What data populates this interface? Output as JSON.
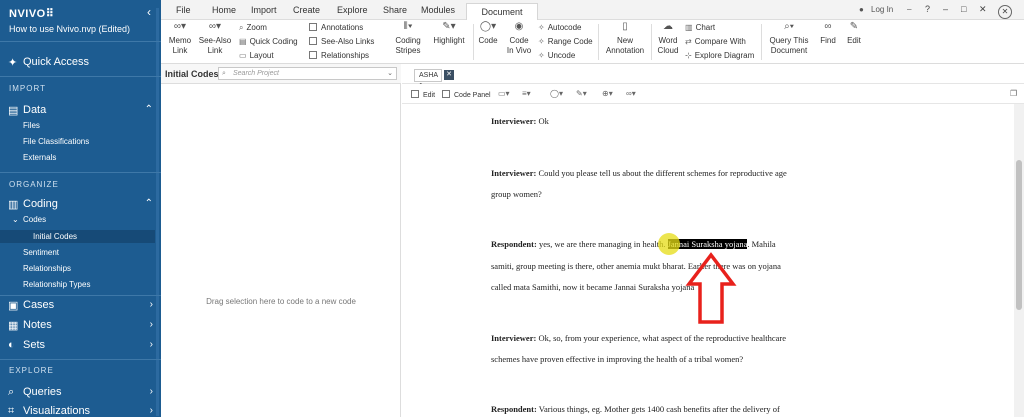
{
  "sidebar": {
    "logo": "NVIVO",
    "logo_dots": "⠿",
    "project_name": "How to use Nvivo.nvp (Edited)",
    "quick_access": "Quick Access",
    "sections": {
      "import": "IMPORT",
      "organize": "ORGANIZE",
      "explore": "EXPLORE"
    },
    "data": {
      "label": "Data",
      "items": [
        "Files",
        "File Classifications",
        "Externals"
      ]
    },
    "coding": {
      "label": "Coding",
      "codes_label": "Codes",
      "initial_codes": "Initial Codes",
      "items": [
        "Sentiment",
        "Relationships",
        "Relationship Types"
      ]
    },
    "cases": "Cases",
    "notes": "Notes",
    "sets": "Sets",
    "queries": "Queries",
    "visualizations": "Visualizations"
  },
  "ribbon": {
    "tabs": [
      "File",
      "Home",
      "Import",
      "Create",
      "Explore",
      "Share",
      "Modules"
    ],
    "active_tab": "Document",
    "login": "Log In",
    "buttons": {
      "memo_link": [
        "Memo",
        "Link"
      ],
      "see_also_link": [
        "See-Also",
        "Link"
      ],
      "zoom": "Zoom",
      "quick_coding": "Quick Coding",
      "layout": "Layout",
      "annotations": "Annotations",
      "see_also_links": "See-Also Links",
      "relationships": "Relationships",
      "coding_stripes": [
        "Coding",
        "Stripes"
      ],
      "highlight": "Highlight",
      "code": "Code",
      "code_in_vivo": [
        "Code",
        "In Vivo"
      ],
      "autocode": "Autocode",
      "range_code": "Range Code",
      "uncode": "Uncode",
      "new_annotation": [
        "New",
        "Annotation"
      ],
      "word_cloud": [
        "Word",
        "Cloud"
      ],
      "chart": "Chart",
      "compare_with": "Compare With",
      "explore_diagram": "Explore Diagram",
      "query_this_document": [
        "Query This",
        "Document"
      ],
      "find": "Find",
      "edit": "Edit"
    }
  },
  "left_panel": {
    "title": "Initial Codes",
    "search_placeholder": "Search Project",
    "hint": "Drag selection here to code to a new code"
  },
  "document": {
    "tab_name": "ASHA 1",
    "toolbar": {
      "edit": "Edit",
      "code_panel": "Code Panel"
    },
    "paragraphs": [
      {
        "speaker": "Interviewer:",
        "lines": [
          " Ok"
        ]
      },
      {
        "speaker": "Interviewer:",
        "lines": [
          " Could you please tell us about the different schemes for reproductive age",
          "group women?"
        ]
      },
      {
        "speaker": "Respondent:",
        "lines": [
          "samiti, group meeting is there, other anemia mukt bharat. Earlier there was on yojana",
          "called mata Samithi, now it became Jannai Suraksha yojana"
        ],
        "first_before": " yes, we are there managing in health. ",
        "highlight": "Jannai Suraksha yojana",
        "first_after": ". Mahila"
      },
      {
        "speaker": "Interviewer:",
        "lines": [
          " Ok, so, from your experience, what aspect of the reproductive healthcare",
          "schemes have proven effective in improving the health of a tribal women?"
        ]
      },
      {
        "speaker": "Respondent:",
        "lines": [
          " Various things, eg. Mother gets 1400 cash benefits after the delivery of"
        ]
      }
    ]
  },
  "colors": {
    "sidebar": "#1d5c91",
    "highlight": "#000000",
    "arrow": "#e8211c",
    "cursor": "#e6dc14"
  }
}
